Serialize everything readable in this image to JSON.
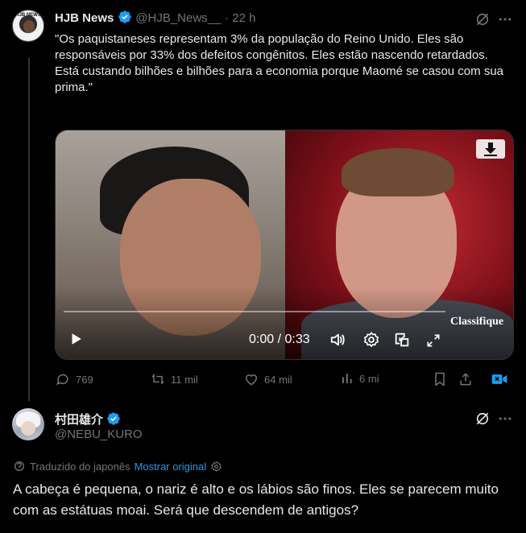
{
  "post": {
    "author_name": "HJB News",
    "handle": "@HJB_News__",
    "separator": "·",
    "time": "22 h",
    "avatar_text": "HJB NEWS",
    "text": "\"Os paquistaneses representam 3% da população do Reino Unido. Eles são responsáveis por 33% dos defeitos congênitos. Eles estão nascendo retardados.\nEstá custando bilhões e bilhões para a economia porque Maomé se casou com sua prima.\"",
    "video": {
      "time_display": "0:00 / 0:33",
      "overlay_label": "Classifique",
      "progress_fraction": 0
    },
    "stats": {
      "replies": "769",
      "reposts": "11 mil",
      "likes": "64 mil",
      "views": "6 mi"
    }
  },
  "reply": {
    "author_name": "村田雄介",
    "handle": "@NEBU_KURO",
    "translated_note": "Traduzido do japonês",
    "show_original": "Mostrar original",
    "text": "A cabeça é pequena, o nariz é alto e os lábios são finos. Eles se parecem muito com as estátuas moai. Será que descendem de antigos?"
  },
  "colors": {
    "background": "#000000",
    "text": "#e7e9ea",
    "muted": "#71767b",
    "accent": "#1d9bf0",
    "video_accent": "#1d9bf0"
  }
}
